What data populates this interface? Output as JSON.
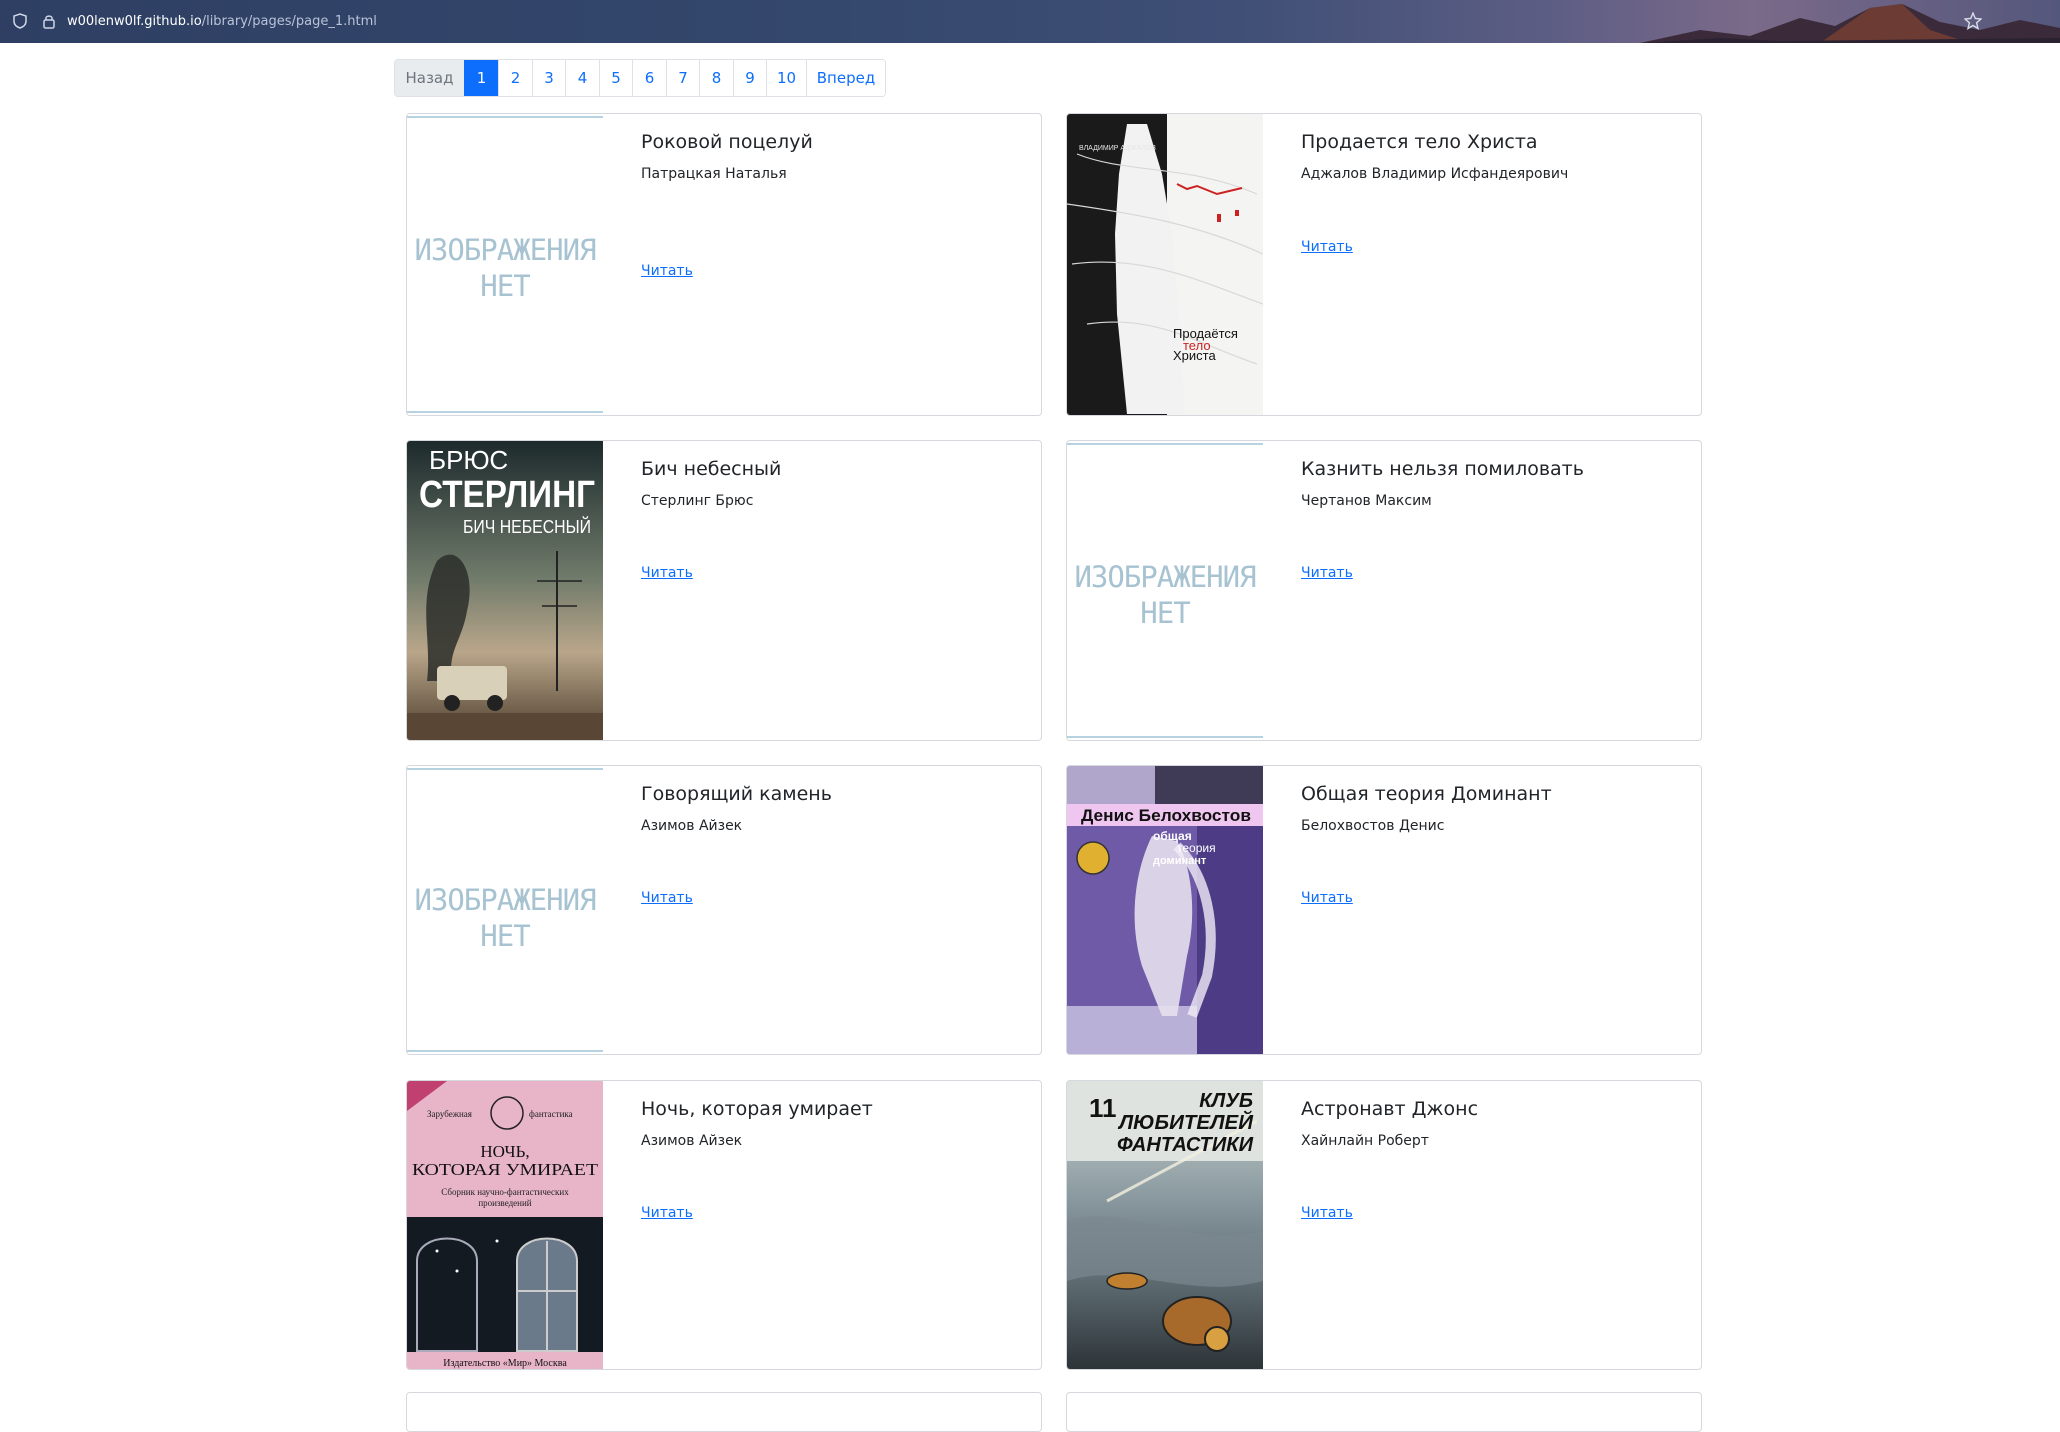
{
  "browser": {
    "url_host": "w00lenw0lf.github.io",
    "url_path": "/library/pages/page_1.html"
  },
  "pagination": {
    "prev_label": "Назад",
    "next_label": "Вперед",
    "pages": [
      "1",
      "2",
      "3",
      "4",
      "5",
      "6",
      "7",
      "8",
      "9",
      "10"
    ],
    "active_page": "1"
  },
  "no_image_text": {
    "line1": "ИЗОБРАЖЕНИЯ",
    "line2": "НЕТ"
  },
  "read_label": "Читать",
  "books": [
    {
      "title": "Роковой поцелуй",
      "author": "Патрацкая Наталья",
      "cover": "no-image"
    },
    {
      "title": "Продается тело Христа",
      "author": "Аджалов Владимир Исфандеярович",
      "cover": "prodaetsya",
      "cover_text": {
        "line1": "Продаётся",
        "line2": "тело",
        "line3": "Христа",
        "small": "ВЛАДИМИР АДЖАЛОВ"
      }
    },
    {
      "title": "Бич небесный",
      "author": "Стерлинг Брюс",
      "cover": "bich",
      "cover_text": {
        "line1": "БРЮС",
        "line2": "СТЕРЛИНГ",
        "line3": "БИЧ НЕБЕСНЫЙ"
      }
    },
    {
      "title": "Казнить нельзя помиловать",
      "author": "Чертанов Максим",
      "cover": "no-image"
    },
    {
      "title": "Говорящий камень",
      "author": "Азимов Айзек",
      "cover": "no-image"
    },
    {
      "title": "Общая теория Доминант",
      "author": "Белохвостов Денис",
      "cover": "dominant",
      "cover_text": {
        "line1": "Денис Белохвостов",
        "line2": "общая",
        "line3": "теория",
        "line4": "доминант"
      }
    },
    {
      "title": "Ночь, которая умирает",
      "author": "Азимов Айзек",
      "cover": "noch",
      "cover_text": {
        "line1": "Зарубежная",
        "line2": "фантастика",
        "line3": "НОЧЬ,",
        "line4": "КОТОРАЯ УМИРАЕТ",
        "line5": "Сборник научно-фантастических",
        "line6": "произведений",
        "line7": "Издательство «Мир» Москва"
      }
    },
    {
      "title": "Астронавт Джонс",
      "author": "Хайнлайн Роберт",
      "cover": "astronavt",
      "cover_text": {
        "number": "11",
        "line1": "КЛУБ",
        "line2": "ЛЮБИТЕЛЕЙ",
        "line3": "ФАНТАСТИКИ"
      }
    }
  ]
}
